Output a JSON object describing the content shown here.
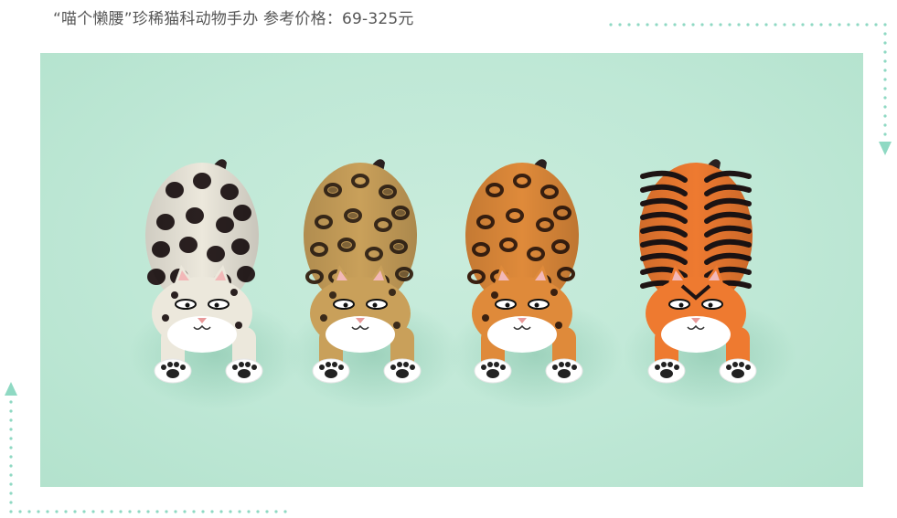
{
  "caption": {
    "text": "“喵个懒腰”珍稀猫科动物手办 参考价格：69-325元"
  },
  "colors": {
    "background": "#bfe8d6",
    "dotted_border": "#8fd9c3",
    "caption_text": "#555555"
  },
  "figures": [
    {
      "name": "snow-leopard",
      "body": "#ece8dc",
      "belly": "#ffffff",
      "mark": "#2a2020"
    },
    {
      "name": "clouded-leopard",
      "body": "#c9a05a",
      "belly": "#ffffff",
      "mark": "#3a2a1a"
    },
    {
      "name": "leopard",
      "body": "#df8a3a",
      "belly": "#ffffff",
      "mark": "#3a2010"
    },
    {
      "name": "tiger",
      "body": "#ee7a30",
      "belly": "#ffffff",
      "mark": "#1e1414"
    }
  ]
}
